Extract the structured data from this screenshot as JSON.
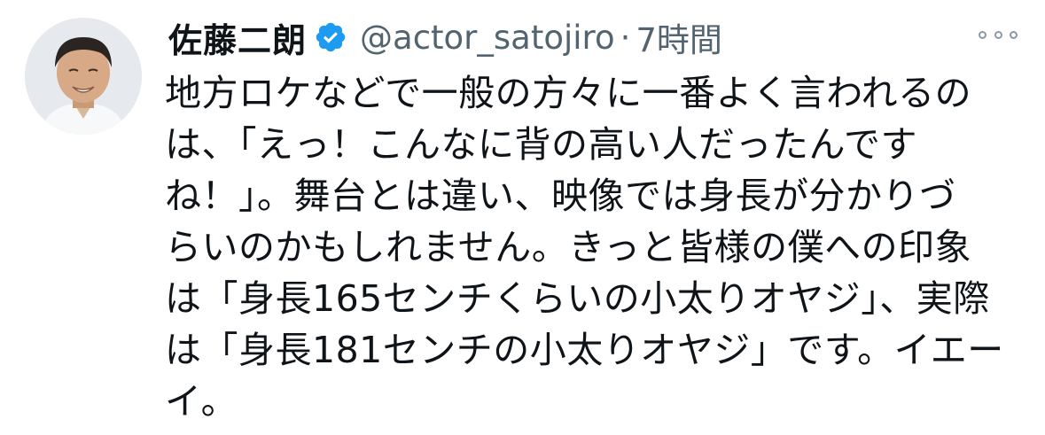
{
  "tweet": {
    "author": {
      "display_name": "佐藤二朗",
      "verified_icon": "verified-badge-icon",
      "handle": "@actor_satojiro",
      "avatar_icon": "user-avatar"
    },
    "separator": "·",
    "timestamp": "7時間",
    "more_icon": "more-options-icon",
    "text_lines": [
      "地方ロケなどで一般の方々に一番よく言われるの",
      "は、「えっ！こんなに背の高い人だったんです",
      "ね！」。舞台とは違い、映像では身長が分かりづ",
      "らいのかもしれません。きっと皆様の僕への印象",
      "は「身長165センチくらいの小太りオヤジ」、実際",
      "は「身長181センチの小太りオヤジ」です。イエー",
      "イ。"
    ]
  },
  "colors": {
    "text_primary": "#0f1419",
    "text_secondary": "#536471",
    "verified_blue": "#1d9bf0",
    "more_dots": "#8b98a5"
  }
}
